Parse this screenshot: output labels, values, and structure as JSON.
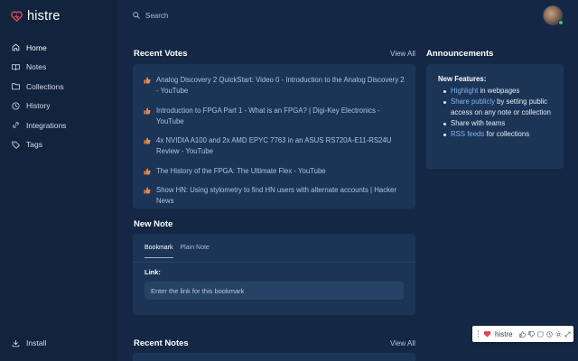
{
  "app": {
    "title": "histre"
  },
  "sidebar": {
    "items": [
      {
        "label": "Home",
        "icon": "home-icon",
        "active": true
      },
      {
        "label": "Notes",
        "icon": "book-icon",
        "active": false
      },
      {
        "label": "Collections",
        "icon": "folder-icon",
        "active": false
      },
      {
        "label": "History",
        "icon": "clock-icon",
        "active": false
      },
      {
        "label": "Integrations",
        "icon": "link-icon",
        "active": false
      },
      {
        "label": "Tags",
        "icon": "tag-icon",
        "active": false
      }
    ],
    "install_label": "Install"
  },
  "search": {
    "placeholder": "Search"
  },
  "recent_votes": {
    "title": "Recent Votes",
    "view_all": "View All",
    "items": [
      "Analog Discovery 2 QuickStart: Video 0 - Introduction to the Analog Discovery 2 - YouTube",
      "Introduction to FPGA Part 1 - What is an FPGA? | Digi-Key Electronics - YouTube",
      "4x NVIDIA A100 and 2x AMD EPYC 7763 in an ASUS RS720A-E11-RS24U Review - YouTube",
      "The History of the FPGA: The Ultimate Flex - YouTube",
      "Show HN: Using stylometry to find HN users with alternate accounts | Hacker News"
    ]
  },
  "announcements": {
    "title": "Announcements",
    "heading": "New Features:",
    "items": [
      {
        "highlight": "Highlight",
        "rest": " in webpages"
      },
      {
        "highlight": "Share publicly",
        "rest": " by setting public access on any note or collection"
      },
      {
        "highlight": "",
        "rest": "Share with teams"
      },
      {
        "highlight": "RSS feeds",
        "rest": " for collections"
      }
    ]
  },
  "new_note": {
    "title": "New Note",
    "tabs": [
      "Bookmark",
      "Plain Note"
    ],
    "link_label": "Link:",
    "link_placeholder": "Enter the link for this bookmark"
  },
  "recent_notes": {
    "title": "Recent Notes",
    "view_all": "View All"
  },
  "extension": {
    "label": "histre"
  },
  "colors": {
    "background": "#142846",
    "sidebar": "#12233d",
    "card": "#1c3557",
    "brand_heart": "#e0445a",
    "vote_icon": "#e8884a",
    "link": "#7fb2ee"
  }
}
